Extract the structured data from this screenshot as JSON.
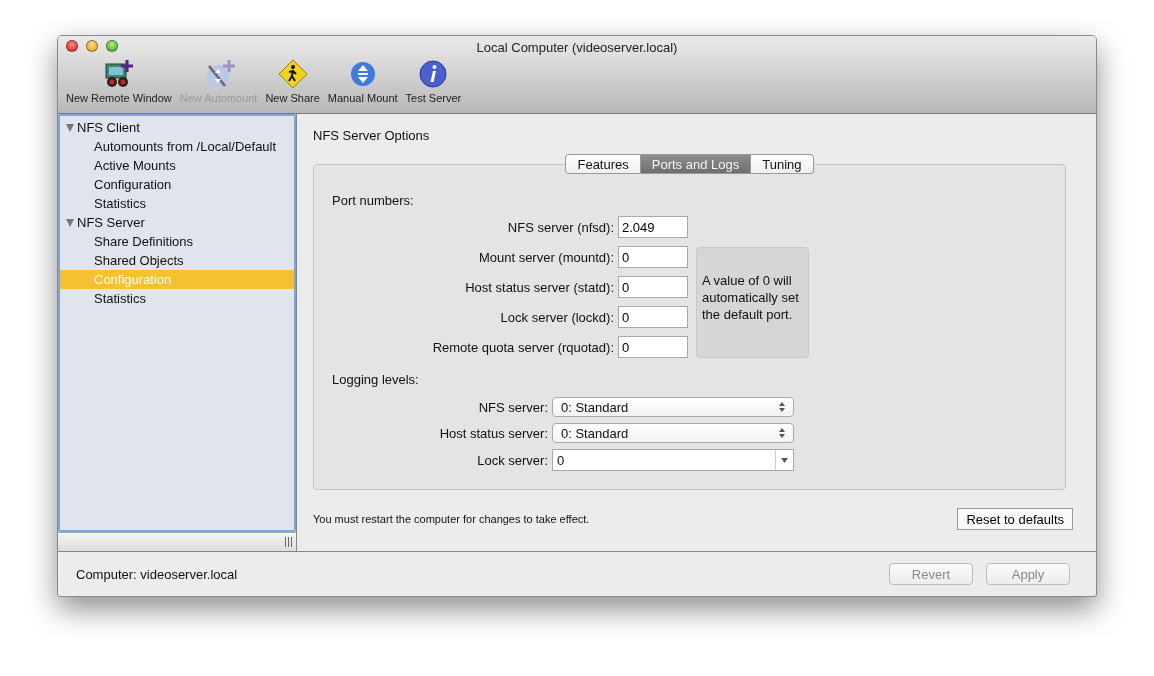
{
  "window": {
    "title": "Local Computer (videoserver.local)"
  },
  "toolbar": [
    {
      "label": "New Remote Window",
      "kind": "remote",
      "disabled": false
    },
    {
      "label": "New Automount",
      "kind": "automount",
      "disabled": true
    },
    {
      "label": "New Share",
      "kind": "share",
      "disabled": false
    },
    {
      "label": "Manual Mount",
      "kind": "mount",
      "disabled": false
    },
    {
      "label": "Test Server",
      "kind": "info",
      "disabled": false
    }
  ],
  "sidebar": {
    "items": [
      {
        "label": "NFS Client",
        "expanded": true,
        "selected": false,
        "children": [
          {
            "label": "Automounts from /Local/Default",
            "selected": false
          },
          {
            "label": "Active Mounts",
            "selected": false
          },
          {
            "label": "Configuration",
            "selected": false
          },
          {
            "label": "Statistics",
            "selected": false
          }
        ]
      },
      {
        "label": "NFS Server",
        "expanded": true,
        "selected": false,
        "children": [
          {
            "label": "Share Definitions",
            "selected": false
          },
          {
            "label": "Shared Objects",
            "selected": false
          },
          {
            "label": "Configuration",
            "selected": true
          },
          {
            "label": "Statistics",
            "selected": false
          }
        ]
      }
    ]
  },
  "panel": {
    "title": "NFS Server Options",
    "tabs": [
      {
        "label": "Features",
        "selected": false
      },
      {
        "label": "Ports and Logs",
        "selected": true
      },
      {
        "label": "Tuning",
        "selected": false
      }
    ],
    "port_heading": "Port numbers:",
    "ports": [
      {
        "label": "NFS server (nfsd):",
        "value": "2.049"
      },
      {
        "label": "Mount server (mountd):",
        "value": "0"
      },
      {
        "label": "Host status server (statd):",
        "value": "0"
      },
      {
        "label": "Lock server (lockd):",
        "value": "0"
      },
      {
        "label": "Remote quota server (rquotad):",
        "value": "0"
      }
    ],
    "port_note": "A value of 0 will automatically set the default port.",
    "logging_heading": "Logging levels:",
    "logging": [
      {
        "label": "NFS server:",
        "value": "0: Standard",
        "kind": "popup"
      },
      {
        "label": "Host status server:",
        "value": "0: Standard",
        "kind": "popup"
      },
      {
        "label": "Lock server:",
        "value": "0",
        "kind": "combo"
      }
    ],
    "restart_note": "You must restart the computer for changes to take effect.",
    "reset_button": "Reset to defaults"
  },
  "status_bar": {
    "computer": "Computer: videoserver.local",
    "buttons": [
      {
        "label": "Revert",
        "disabled": true
      },
      {
        "label": "Apply",
        "disabled": true
      }
    ]
  }
}
